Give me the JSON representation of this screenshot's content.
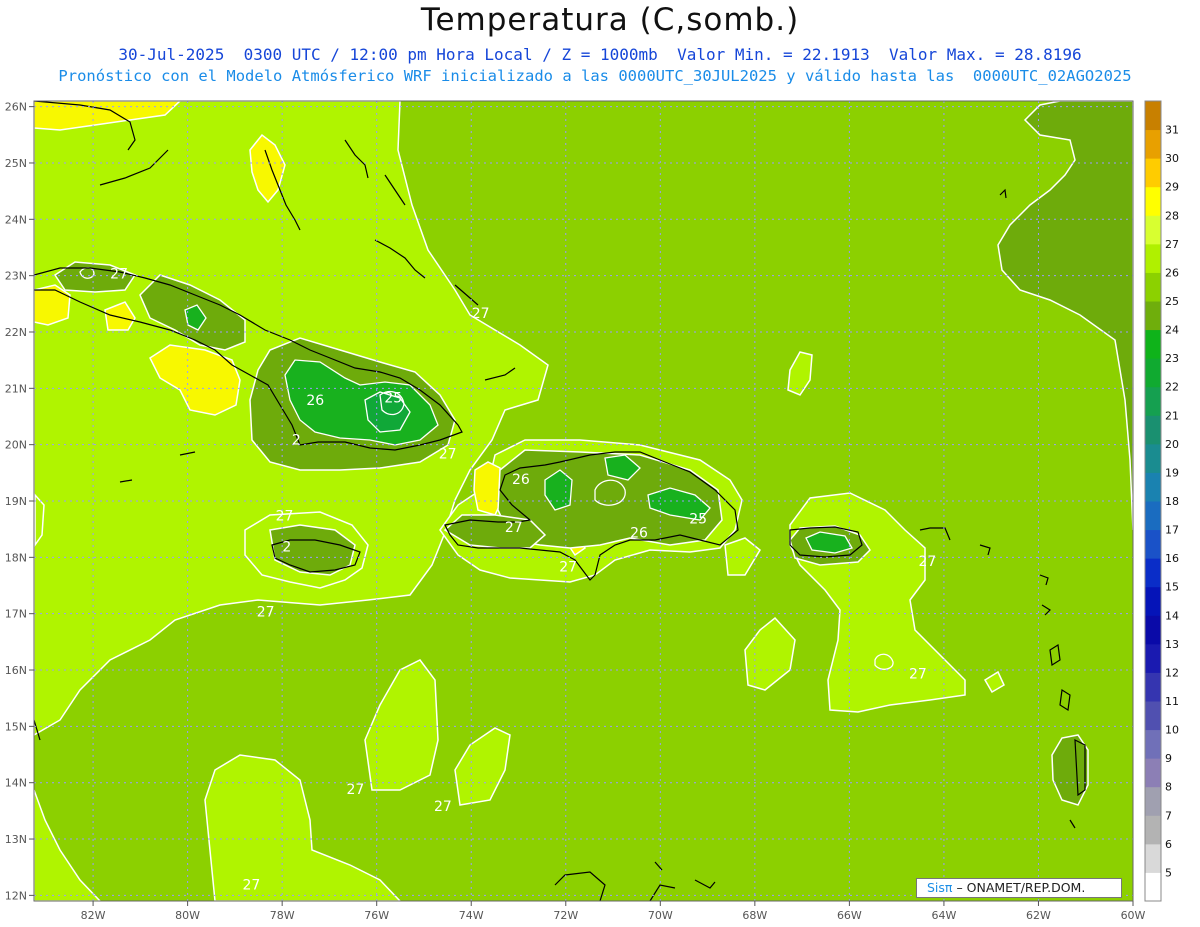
{
  "header": {
    "title": "Temperatura (C,somb.)",
    "line1": "30-Jul-2025  0300 UTC / 12:00 pm Hora Local / Z = 1000mb  Valor Min. = 22.1913  Valor Max. = 28.8196",
    "line2": "Pronóstico con el Modelo Atmósferico WRF inicializado a las 0000UTC_30JUL2025 y válido hasta las  0000UTC_02AGO2025"
  },
  "map": {
    "lon_range": [
      -83.25,
      -60.0
    ],
    "lat_range": [
      11.9,
      26.1
    ],
    "lon_ticks": [
      -82,
      -80,
      -78,
      -76,
      -74,
      -72,
      -70,
      -68,
      -66,
      -64,
      -62,
      -60
    ],
    "lon_tick_labels": [
      "82W",
      "80W",
      "78W",
      "76W",
      "74W",
      "72W",
      "70W",
      "68W",
      "66W",
      "64W",
      "62W",
      "60W"
    ],
    "lat_ticks": [
      12,
      13,
      14,
      15,
      16,
      17,
      18,
      19,
      20,
      21,
      22,
      23,
      24,
      25,
      26
    ],
    "lat_tick_labels": [
      "12N",
      "13N",
      "14N",
      "15N",
      "16N",
      "17N",
      "18N",
      "19N",
      "20N",
      "21N",
      "22N",
      "23N",
      "24N",
      "25N",
      "26N"
    ],
    "contour_labels": [
      {
        "text": "27",
        "lon": -81.45,
        "lat": 22.95
      },
      {
        "text": "27",
        "lon": -73.8,
        "lat": 22.25
      },
      {
        "text": "26",
        "lon": -77.3,
        "lat": 20.7
      },
      {
        "text": "25",
        "lon": -75.65,
        "lat": 20.75
      },
      {
        "text": "2",
        "lon": -77.7,
        "lat": 20.0
      },
      {
        "text": "27",
        "lon": -74.5,
        "lat": 19.75
      },
      {
        "text": "26",
        "lon": -72.95,
        "lat": 19.3
      },
      {
        "text": "27",
        "lon": -77.95,
        "lat": 18.65
      },
      {
        "text": "2",
        "lon": -77.9,
        "lat": 18.1
      },
      {
        "text": "27",
        "lon": -73.1,
        "lat": 18.45
      },
      {
        "text": "27",
        "lon": -71.95,
        "lat": 17.75
      },
      {
        "text": "26",
        "lon": -70.45,
        "lat": 18.35
      },
      {
        "text": "25",
        "lon": -69.2,
        "lat": 18.6
      },
      {
        "text": "27",
        "lon": -64.35,
        "lat": 17.85
      },
      {
        "text": "27",
        "lon": -78.35,
        "lat": 16.95
      },
      {
        "text": "27",
        "lon": -64.55,
        "lat": 15.85
      },
      {
        "text": "27",
        "lon": -76.45,
        "lat": 13.8
      },
      {
        "text": "27",
        "lon": -74.6,
        "lat": 13.5
      },
      {
        "text": "27",
        "lon": -78.65,
        "lat": 12.1
      }
    ]
  },
  "colorbar": {
    "levels": [
      "5",
      "6",
      "7",
      "8",
      "9",
      "10",
      "11",
      "12",
      "13",
      "14",
      "15",
      "16",
      "17",
      "18",
      "19",
      "20",
      "21",
      "22",
      "23",
      "24",
      "25",
      "26",
      "27",
      "28",
      "29",
      "30",
      "31"
    ],
    "colors": [
      "#ffffff",
      "#d9d9d9",
      "#b3b3b3",
      "#a0a0b0",
      "#8c7fb5",
      "#7070b8",
      "#5050b0",
      "#3535b0",
      "#1a1ab0",
      "#0a0aa8",
      "#0514b8",
      "#0a2dc8",
      "#1a52c8",
      "#1a6cc0",
      "#1a82b0",
      "#1a8c90",
      "#1a9070",
      "#15a050",
      "#10aa30",
      "#0fb31a",
      "#6fae0c",
      "#8cd100",
      "#b0f000",
      "#d8ff30",
      "#ffff00",
      "#ffcc00",
      "#e8a000",
      "#c88000"
    ]
  },
  "credit": {
    "brand": "Sisπ",
    "org": "– ONAMET/REP.DOM."
  },
  "colors": {
    "sea_26": "#8cd000",
    "warm_27": "#b0f400",
    "hot_28": "#f8f800",
    "cool_25": "#6eab0b",
    "cool_24": "#18b11e",
    "contour": "#ffffff",
    "coast": "#000000",
    "grid": "#9a9aff"
  }
}
